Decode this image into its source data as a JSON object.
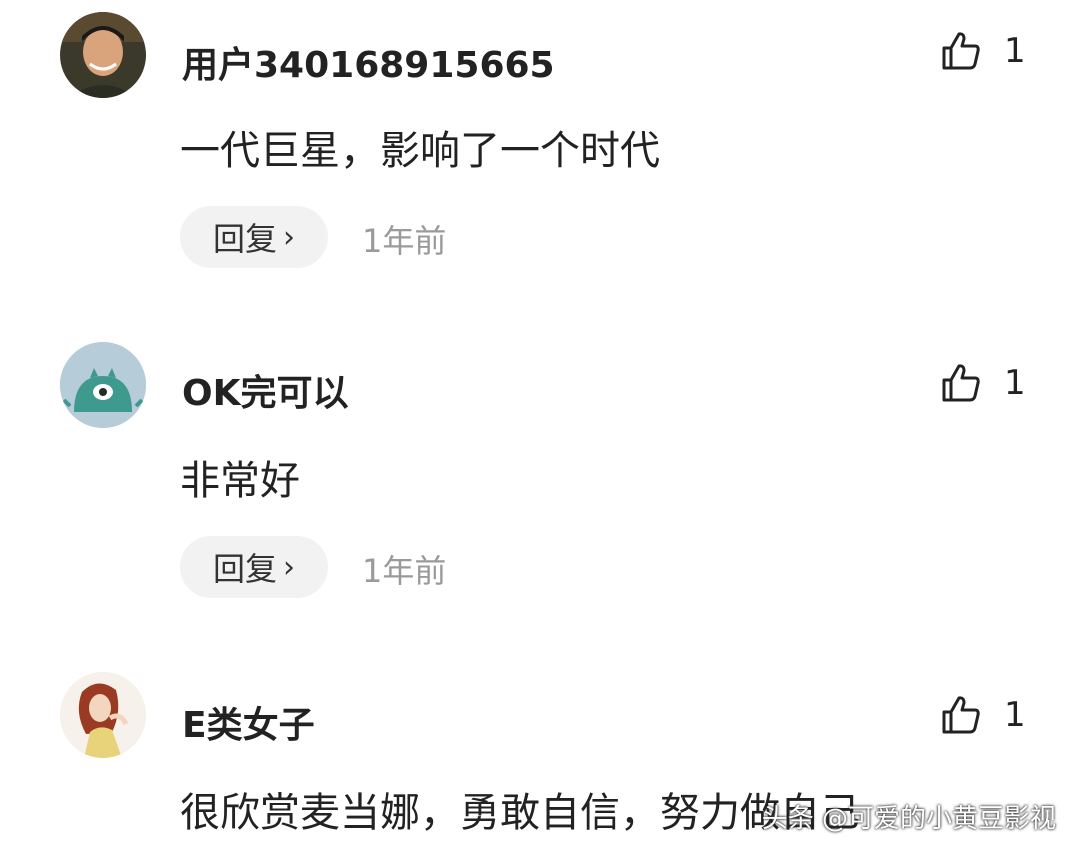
{
  "comments": [
    {
      "username": "用户340168915665",
      "content": "一代巨星，影响了一个时代",
      "likes": "1",
      "reply_label": "回复",
      "time": "1年前",
      "avatar": "photo-avatar-man"
    },
    {
      "username": "OK完可以",
      "content": "非常好",
      "likes": "1",
      "reply_label": "回复",
      "time": "1年前",
      "avatar": "teal-monster-avatar"
    },
    {
      "username": "E类女子",
      "content": "很欣赏麦当娜，勇敢自信，努力做自己",
      "likes": "1",
      "avatar": "illustrated-woman-avatar"
    }
  ],
  "icons": {
    "like": "thumbs-up-outline-icon",
    "reply_chevron": "chevron-right-icon"
  },
  "watermark": "头条 @可爱的小黄豆影视",
  "colors": {
    "text": "#222222",
    "muted": "#9a9a9a",
    "reply_bg": "#f2f2f2"
  }
}
